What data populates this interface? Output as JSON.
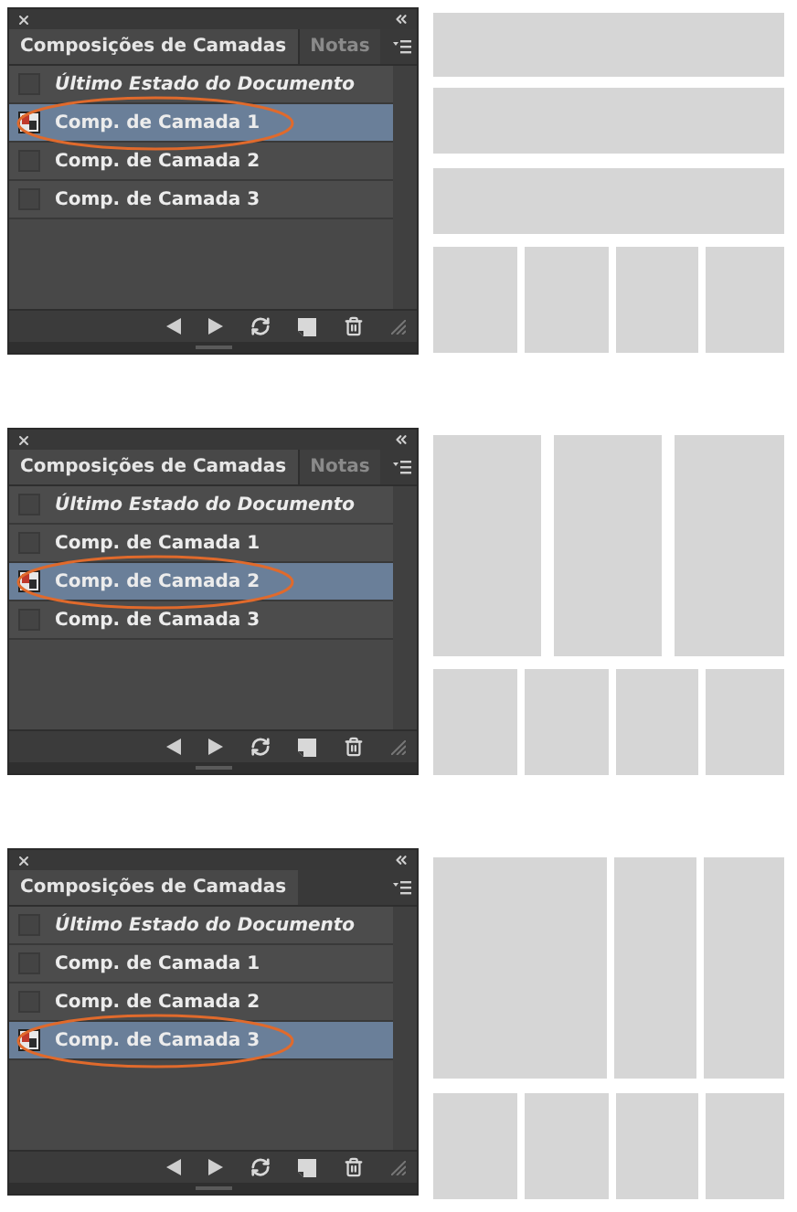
{
  "sections": [
    {
      "tabs": [
        {
          "label": "Composições de Camadas",
          "selected": true
        },
        {
          "label": "Notas",
          "selected": false
        }
      ],
      "items": [
        {
          "kind": "last-state",
          "label": "Último Estado do Documento",
          "selected": false
        },
        {
          "kind": "comp",
          "label": "Comp. de Camada 1",
          "selected": true
        },
        {
          "kind": "comp",
          "label": "Comp. de Camada 2",
          "selected": false
        },
        {
          "kind": "comp",
          "label": "Comp. de Camada 3",
          "selected": false
        }
      ],
      "layout": {
        "kind": "bars"
      }
    },
    {
      "tabs": [
        {
          "label": "Composições de Camadas",
          "selected": true
        },
        {
          "label": "Notas",
          "selected": false
        }
      ],
      "items": [
        {
          "kind": "last-state",
          "label": "Último Estado do Documento",
          "selected": false
        },
        {
          "kind": "comp",
          "label": "Comp. de Camada 1",
          "selected": false
        },
        {
          "kind": "comp",
          "label": "Comp. de Camada 2",
          "selected": true
        },
        {
          "kind": "comp",
          "label": "Comp. de Camada 3",
          "selected": false
        }
      ],
      "layout": {
        "kind": "columns"
      }
    },
    {
      "tabs": [
        {
          "label": "Composições de Camadas",
          "selected": true
        }
      ],
      "items": [
        {
          "kind": "last-state",
          "label": "Último Estado do Documento",
          "selected": false
        },
        {
          "kind": "comp",
          "label": "Comp. de Camada 1",
          "selected": false
        },
        {
          "kind": "comp",
          "label": "Comp. de Camada 2",
          "selected": false
        },
        {
          "kind": "comp",
          "label": "Comp. de Camada 3",
          "selected": true
        }
      ],
      "layout": {
        "kind": "wide-left"
      }
    }
  ]
}
